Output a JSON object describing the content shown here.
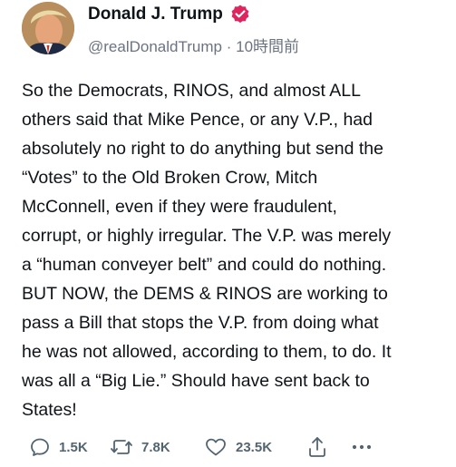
{
  "author": {
    "name": "Donald J. Trump",
    "handle": "@realDonaldTrump",
    "separator": "·",
    "time": "10時間前",
    "avatar_icon": "profile-photo"
  },
  "post": {
    "text": "So the Democrats, RINOS, and almost ALL\nothers said that Mike Pence, or any V.P., had\nabsolutely no right to do anything but send the\n“Votes” to the Old Broken Crow, Mitch\nMcConnell, even if they were fraudulent,\ncorrupt, or highly irregular. The V.P. was merely\na “human conveyer belt” and could do nothing.\nBUT NOW, the DEMS & RINOS are working to\npass a Bill that stops the V.P. from doing what\nhe was not allowed, according to them, to do. It\nwas all a “Big Lie.” Should have sent back to\nStates!"
  },
  "actions": {
    "reply": {
      "icon": "reply-icon",
      "count": "1.5K"
    },
    "repost": {
      "icon": "repost-icon",
      "count": "7.8K"
    },
    "like": {
      "icon": "heart-icon",
      "count": "23.5K"
    },
    "share": {
      "icon": "share-icon"
    },
    "more": {
      "icon": "more-icon"
    }
  },
  "colors": {
    "verified_badge": "#e0245e",
    "muted_text": "#6b7280",
    "action_icon": "#536471",
    "text": "#0f1419"
  }
}
